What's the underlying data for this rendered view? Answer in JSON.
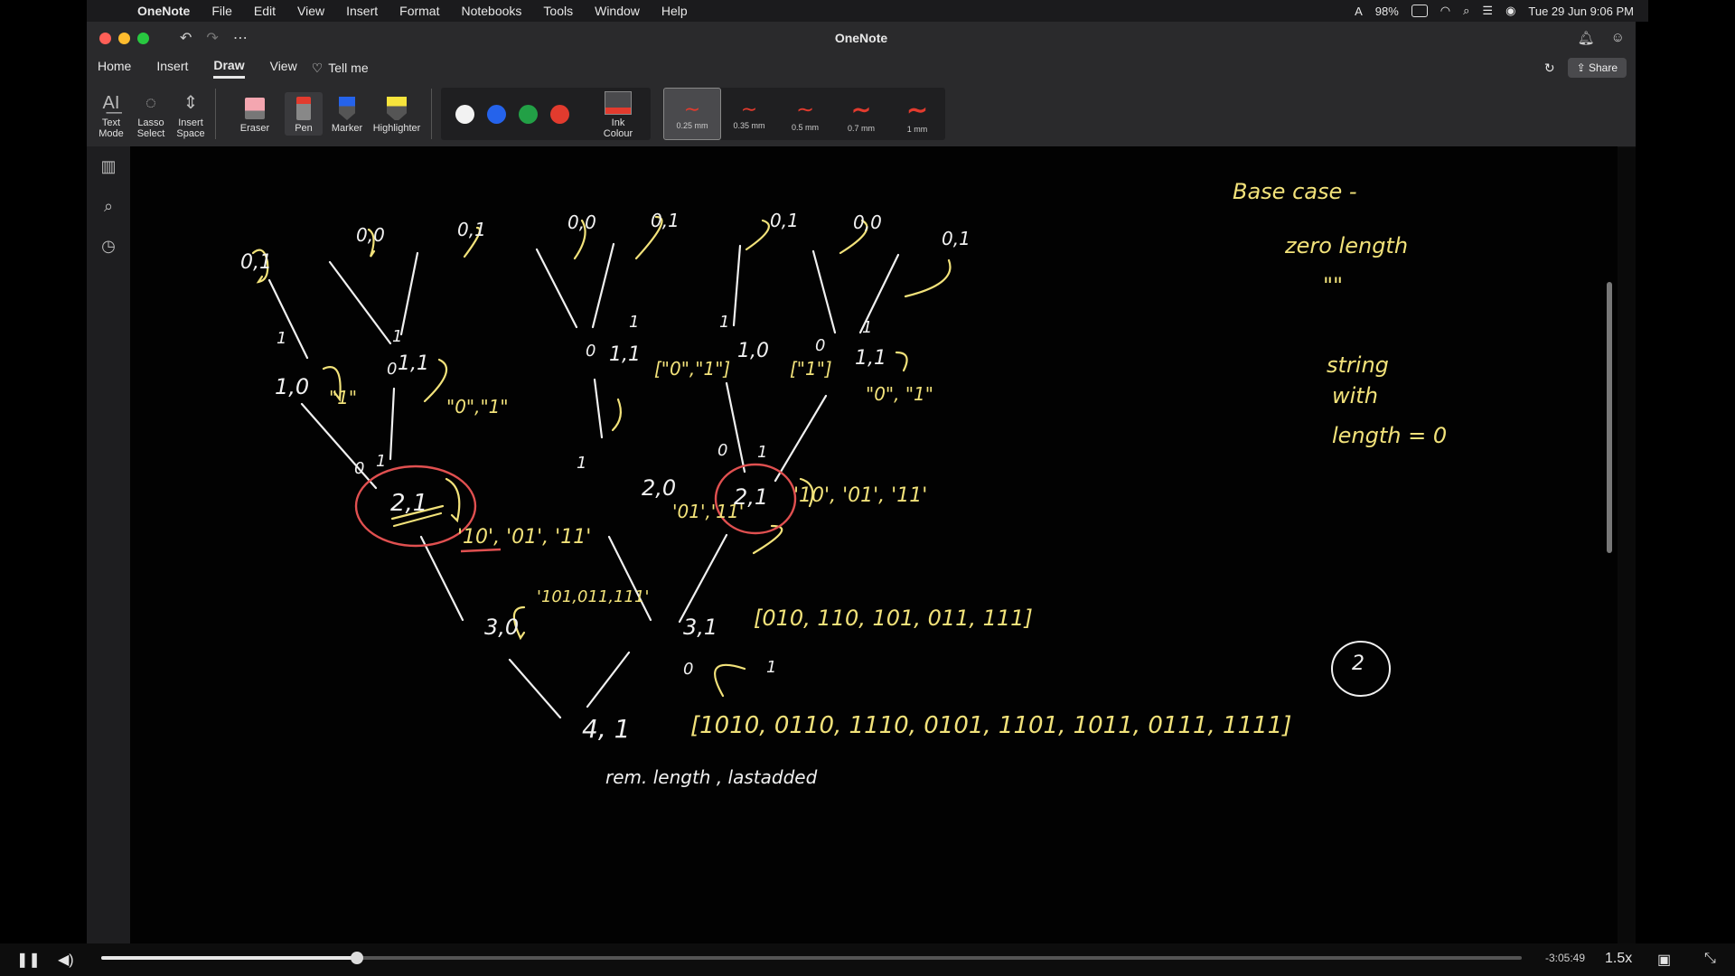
{
  "menubar": {
    "app": "OneNote",
    "items": [
      "File",
      "Edit",
      "View",
      "Insert",
      "Format",
      "Notebooks",
      "Tools",
      "Window",
      "Help"
    ],
    "battery": "98%",
    "datetime": "Tue 29 Jun 9:06 PM"
  },
  "window": {
    "title": "OneNote",
    "tabs": [
      "Home",
      "Insert",
      "Draw",
      "View"
    ],
    "active_tab": "Draw",
    "tell_me": "Tell me",
    "share": "Share"
  },
  "ribbon": {
    "tools": [
      {
        "label": "Text Mode",
        "icon": "text-mode-icon"
      },
      {
        "label": "Lasso Select",
        "icon": "lasso-icon"
      },
      {
        "label": "Insert Space",
        "icon": "insert-space-icon"
      }
    ],
    "draw_tools": [
      {
        "label": "Eraser",
        "icon": "eraser-icon"
      },
      {
        "label": "Pen",
        "icon": "pen-icon"
      },
      {
        "label": "Marker",
        "icon": "marker-icon"
      },
      {
        "label": "Highlighter",
        "icon": "highlighter-icon"
      }
    ],
    "colors": [
      "#f2f2f2",
      "#2563eb",
      "#22a046",
      "#e23b2e"
    ],
    "ink_colour": "Ink Colour",
    "thickness": [
      "0.25 mm",
      "0.35 mm",
      "0.5 mm",
      "0.7 mm",
      "1 mm"
    ],
    "selected_thickness": "0.25 mm"
  },
  "notes": {
    "base_case_title": "Base case -",
    "base_case_lines": [
      "zero length",
      "\"\"",
      "string",
      "with",
      "length = 0"
    ],
    "tree_labels": {
      "l1": [
        "0,1",
        "0,0",
        "0,1",
        "0,0",
        "0,1",
        "0,1",
        "0,0",
        "0,1"
      ],
      "l2": [
        "1,0",
        "1,1",
        "1,1",
        "1,0",
        "1,1"
      ],
      "l2_results": [
        "\"1\"",
        "\"0\",\"1\"",
        "[\"0\",\"1\"]",
        "[\"1\"]",
        "\"0\", \"1\""
      ],
      "l3": [
        "2,1",
        "2,0",
        "2,1"
      ],
      "l3_results": [
        "'10', '01', '11'",
        "'01','11'",
        "'10', '01', '11'"
      ],
      "l4": [
        "3,0",
        "3,1"
      ],
      "l4_results": [
        "'101,011,111'",
        "[010, 110, 101, 011, 111]"
      ],
      "l5": "4, 1",
      "l5_result": "[1010, 0110, 1110, 0101, 1101, 1011, 0111, 1111]",
      "edge_labels": [
        "1",
        "0",
        "1",
        "1",
        "0",
        "1",
        "0",
        "1",
        "1",
        "0",
        "1",
        "0",
        "1",
        "0",
        "1"
      ]
    },
    "footer": "rem. length , lastadded",
    "circled_number": "2"
  },
  "video": {
    "remaining": "-3:05:49",
    "speed": "1.5x",
    "progress": 0.18
  }
}
